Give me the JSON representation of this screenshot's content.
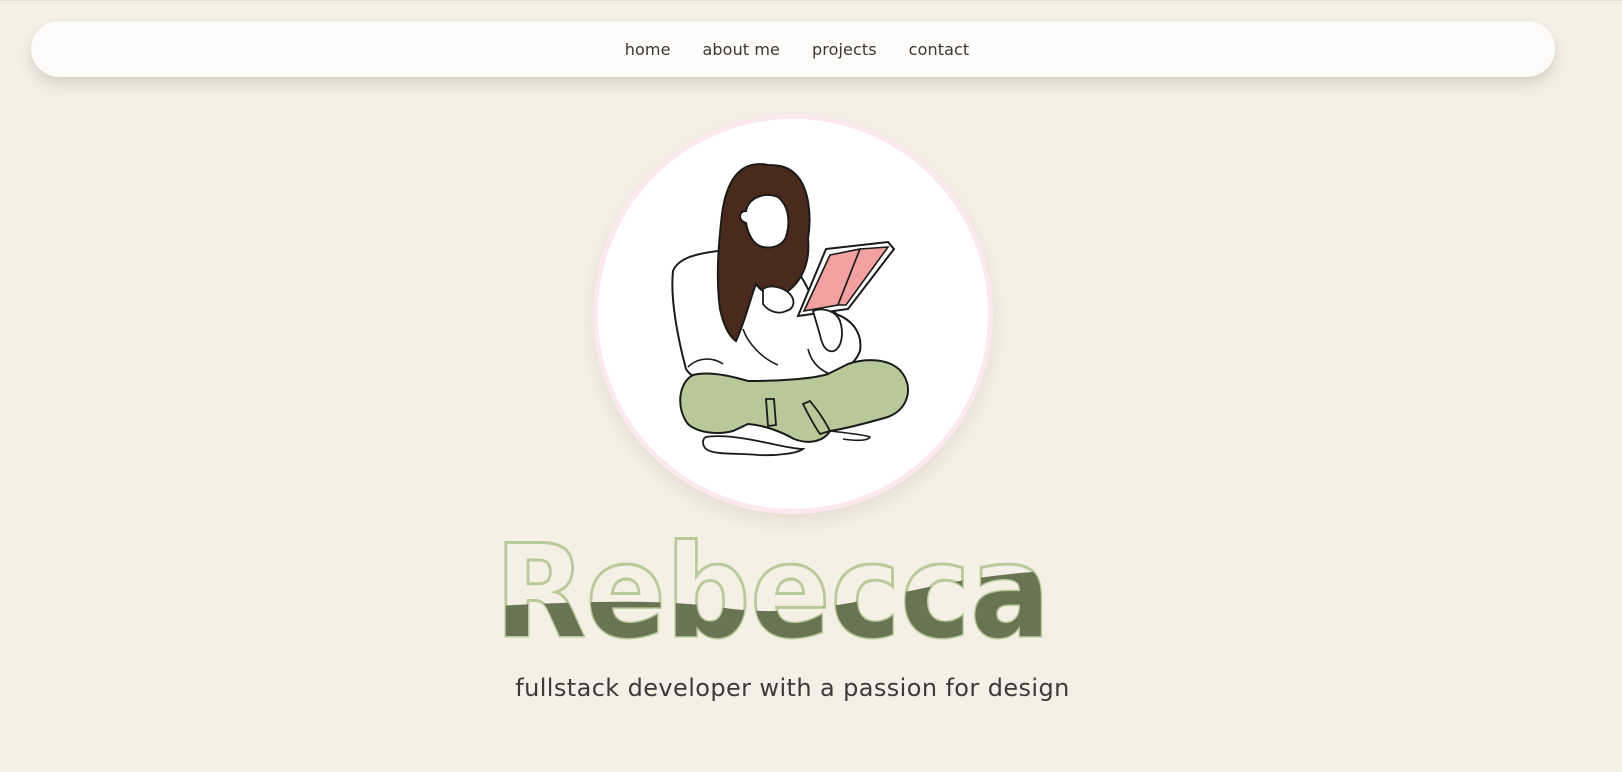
{
  "nav": {
    "items": [
      {
        "label": "home"
      },
      {
        "label": "about me"
      },
      {
        "label": "projects"
      },
      {
        "label": "contact"
      }
    ]
  },
  "hero": {
    "avatar_alt": "illustration of a woman reading a book",
    "name": "Rebecca",
    "tagline": "fullstack developer with a passion for design"
  },
  "colors": {
    "background": "#f5efe6",
    "nav_background": "#fcfbf9",
    "name_outline": "#b8c99a",
    "name_fill": "#677553",
    "avatar_border": "#fbe9ef",
    "hair": "#4a2a1c",
    "pants": "#b7c998",
    "book": "#f2a0a0",
    "text": "#3b3833"
  }
}
